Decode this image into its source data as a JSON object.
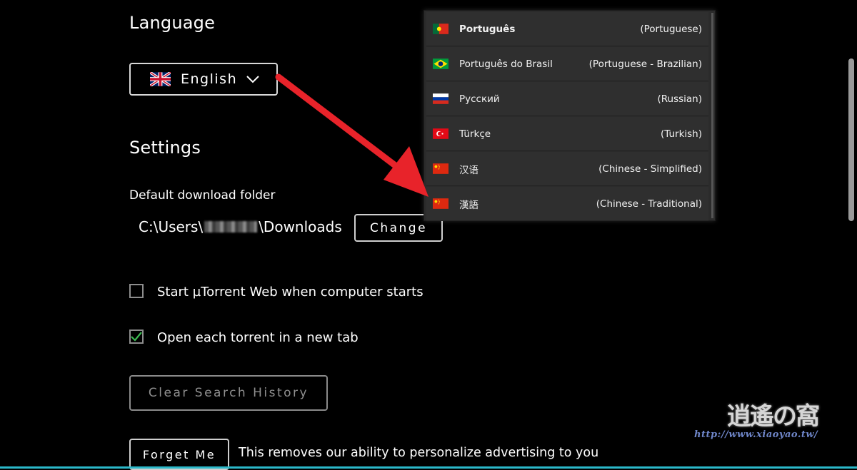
{
  "language": {
    "heading": "Language",
    "selected": "English",
    "options": [
      {
        "native": "Português",
        "english": "(Portuguese)",
        "flag": "portugal-flag-icon",
        "selected": true
      },
      {
        "native": "Português do Brasil",
        "english": "(Portuguese - Brazilian)",
        "flag": "brazil-flag-icon"
      },
      {
        "native": "Русский",
        "english": "(Russian)",
        "flag": "russia-flag-icon"
      },
      {
        "native": "Türkçe",
        "english": "(Turkish)",
        "flag": "turkey-flag-icon"
      },
      {
        "native": "汉语",
        "english": "(Chinese - Simplified)",
        "flag": "china-flag-icon"
      },
      {
        "native": "漢語",
        "english": "(Chinese - Traditional)",
        "flag": "china-flag-icon"
      }
    ]
  },
  "settings": {
    "heading": "Settings",
    "download_folder_label": "Default download folder",
    "path_prefix": "C:\\Users\\",
    "path_suffix": "\\Downloads",
    "change_button": "Change",
    "start_on_boot_label": "Start µTorrent Web when computer starts",
    "start_on_boot_checked": false,
    "new_tab_label": "Open each torrent in a new tab",
    "new_tab_checked": true,
    "clear_history_button": "Clear Search History",
    "forget_me_button": "Forget Me",
    "forget_me_description": "This removes our ability to personalize advertising to you"
  },
  "watermark": {
    "logo_text": "逍遙の窩",
    "url": "http://www.xiaoyao.tw/"
  },
  "colors": {
    "background": "#000000",
    "dropdown_bg": "#2f2f2f",
    "arrow": "#e8232a",
    "check": "#3dbb52",
    "accent_line": "#2bb8c9"
  }
}
